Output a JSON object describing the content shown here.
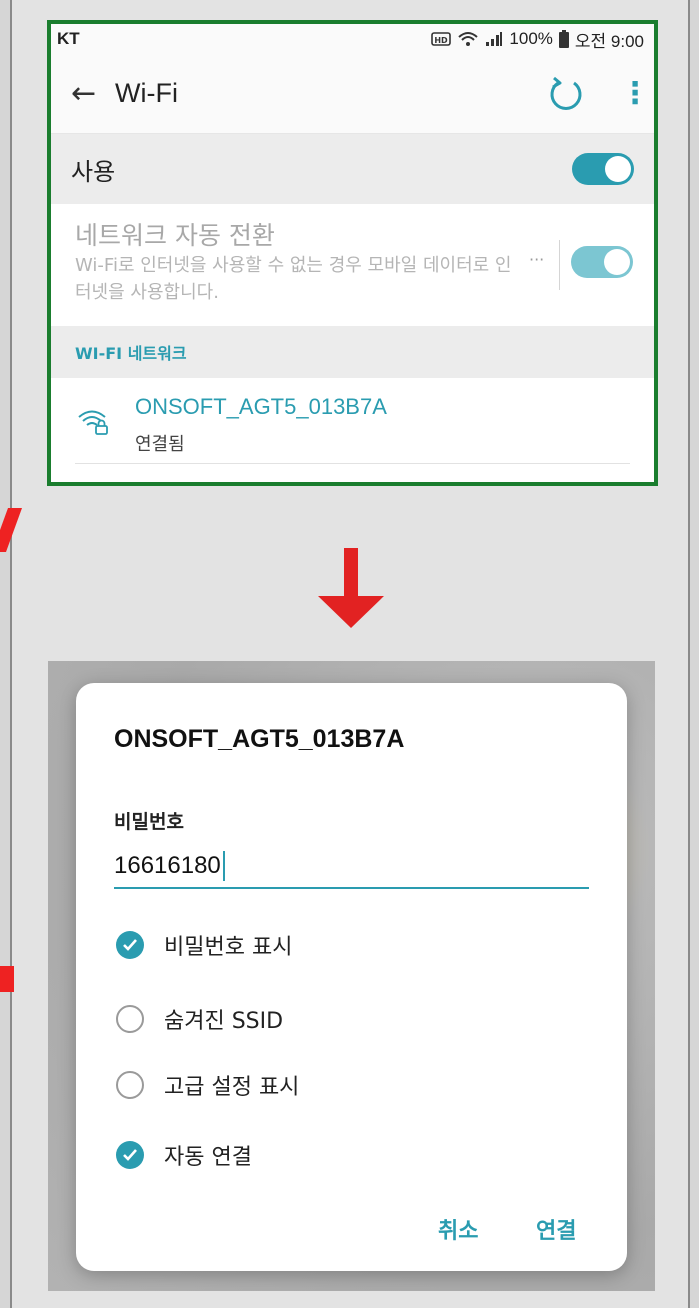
{
  "status_bar": {
    "carrier": "KT",
    "battery": "100%",
    "time": "오전 9:00"
  },
  "app_bar": {
    "title": "Wi-Fi"
  },
  "settings": {
    "use_label": "사용",
    "use_on": true,
    "auto_switch_title": "네트워크 자동 전환",
    "auto_switch_desc": "Wi-Fi로 인터넷을 사용할 수 없는 경우 모바일 데이터로 인터넷을 사용합니다.",
    "auto_switch_more": "···",
    "section_header": "WI-FI 네트워크",
    "network_name": "ONSOFT_AGT5_013B7A",
    "network_status": "연결됨"
  },
  "dialog": {
    "title": "ONSOFT_AGT5_013B7A",
    "password_label": "비밀번호",
    "password_value": "16616180",
    "options": [
      {
        "label": "비밀번호 표시",
        "checked": true
      },
      {
        "label": "숨겨진 SSID",
        "checked": false
      },
      {
        "label": "고급 설정 표시",
        "checked": false
      },
      {
        "label": "자동 연결",
        "checked": true
      }
    ],
    "cancel_label": "취소",
    "connect_label": "연결"
  },
  "colors": {
    "accent": "#2a9cb0",
    "highlight_border": "#1a7d2e",
    "arrow": "#e22222"
  }
}
